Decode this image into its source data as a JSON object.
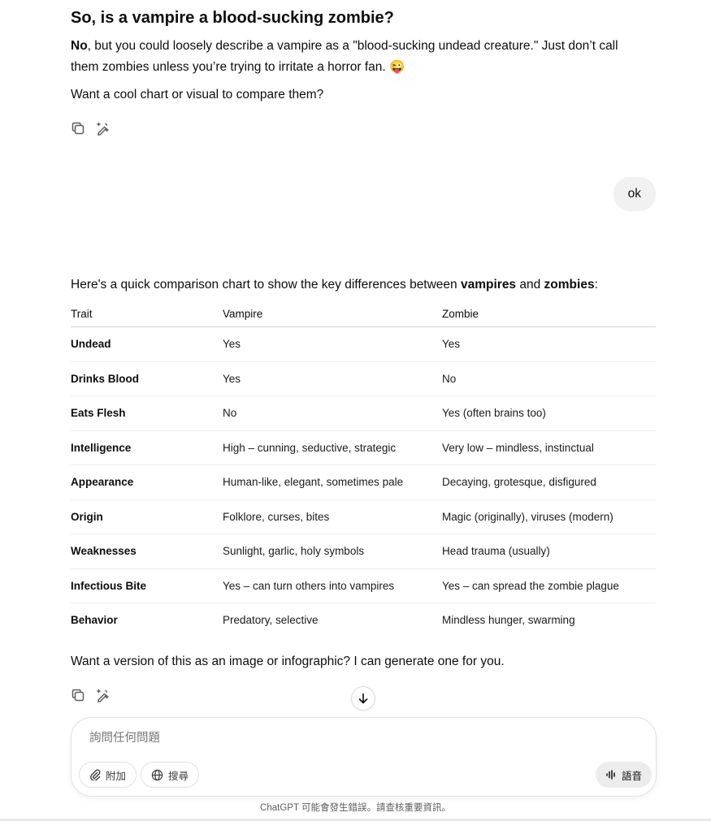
{
  "message1": {
    "heading": "So, is a vampire a blood-sucking zombie?",
    "para1_bold": "No",
    "para1_rest": ", but you could loosely describe a vampire as a \"blood-sucking undead creature.\" Just don’t call them zombies unless you’re trying to irritate a horror fan.",
    "para1_emoji": "😜",
    "para2": "Want a cool chart or visual to compare them?"
  },
  "user_message": "ok",
  "message2": {
    "intro_before": "Here's a quick comparison chart to show the key differences between ",
    "intro_bold1": "vampires",
    "intro_mid": " and ",
    "intro_bold2": "zombies",
    "intro_end": ":",
    "table": {
      "headers": [
        "Trait",
        "Vampire",
        "Zombie"
      ],
      "rows": [
        [
          "Undead",
          "Yes",
          "Yes"
        ],
        [
          "Drinks Blood",
          "Yes",
          "No"
        ],
        [
          "Eats Flesh",
          "No",
          "Yes (often brains too)"
        ],
        [
          "Intelligence",
          "High – cunning, seductive, strategic",
          "Very low – mindless, instinctual"
        ],
        [
          "Appearance",
          "Human-like, elegant, sometimes pale",
          "Decaying, grotesque, disfigured"
        ],
        [
          "Origin",
          "Folklore, curses, bites",
          "Magic (originally), viruses (modern)"
        ],
        [
          "Weaknesses",
          "Sunlight, garlic, holy symbols",
          "Head trauma (usually)"
        ],
        [
          "Infectious Bite",
          "Yes – can turn others into vampires",
          "Yes – can spread the zombie plague"
        ],
        [
          "Behavior",
          "Predatory, selective",
          "Mindless hunger, swarming"
        ]
      ]
    },
    "outro": "Want a version of this as an image or infographic? I can generate one for you."
  },
  "icons": {
    "copy": "copy-icon",
    "edit": "magic-pen-icon",
    "scroll": "arrow-down-icon",
    "attach": "paperclip-icon",
    "search": "globe-icon",
    "voice": "voice-wave-icon"
  },
  "composer": {
    "placeholder": "詢問任何問題",
    "attach_label": "附加",
    "search_label": "搜尋",
    "voice_label": "語音"
  },
  "footer": "ChatGPT 可能會發生錯誤。請查核重要資訊。"
}
